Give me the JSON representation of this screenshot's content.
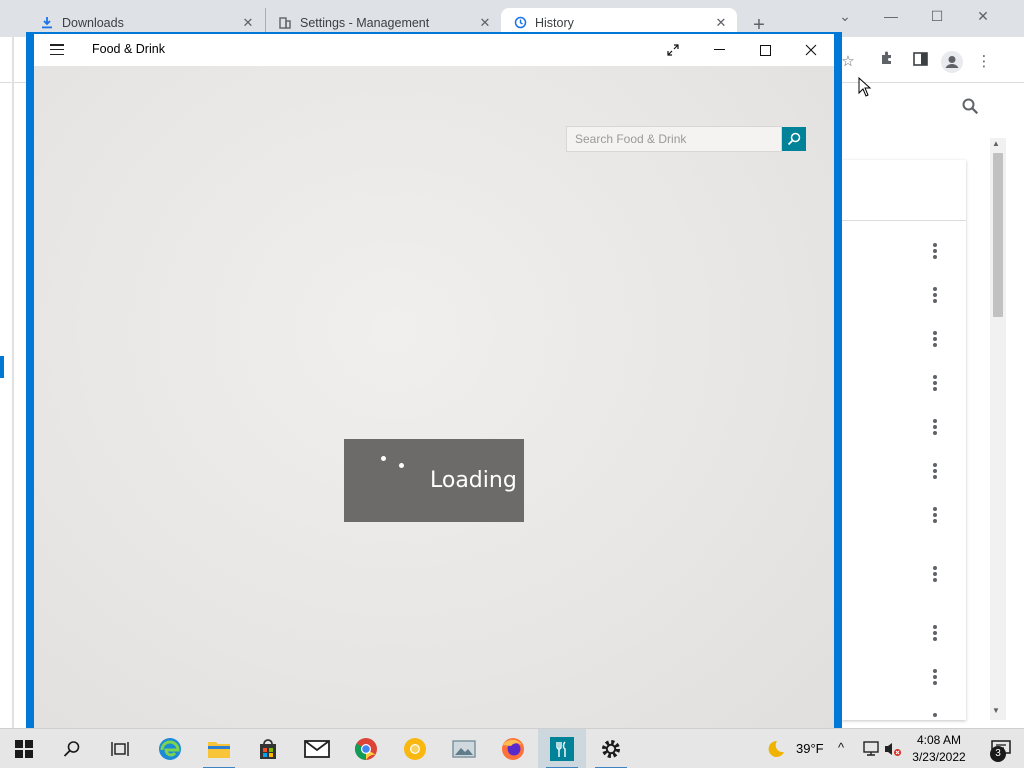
{
  "browser": {
    "tabs": [
      {
        "label": "Downloads",
        "icon": "download-icon"
      },
      {
        "label": "Settings - Management",
        "icon": "building-icon"
      },
      {
        "label": "History",
        "icon": "history-icon"
      }
    ],
    "new_tab_symbol": "+",
    "toolbar_icons": [
      "star-icon",
      "extensions-icon",
      "side-panel-icon",
      "profile-icon",
      "more-menu-icon"
    ],
    "history_item_count": 11
  },
  "app": {
    "title": "Food & Drink",
    "search": {
      "placeholder": "Search Food & Drink"
    },
    "loading_text": "Loading",
    "accent_color": "#0078d7",
    "search_button_color": "#008299"
  },
  "taskbar": {
    "apps": [
      "start",
      "search",
      "task-view",
      "edge",
      "file-explorer",
      "store",
      "mail",
      "chrome",
      "chrome-canary",
      "photos",
      "firefox",
      "food-drink",
      "settings"
    ],
    "weather": {
      "temperature": "39°F",
      "icon": "moon-icon"
    },
    "clock": {
      "time": "4:08 AM",
      "date": "3/23/2022"
    },
    "notification_count": "3"
  }
}
